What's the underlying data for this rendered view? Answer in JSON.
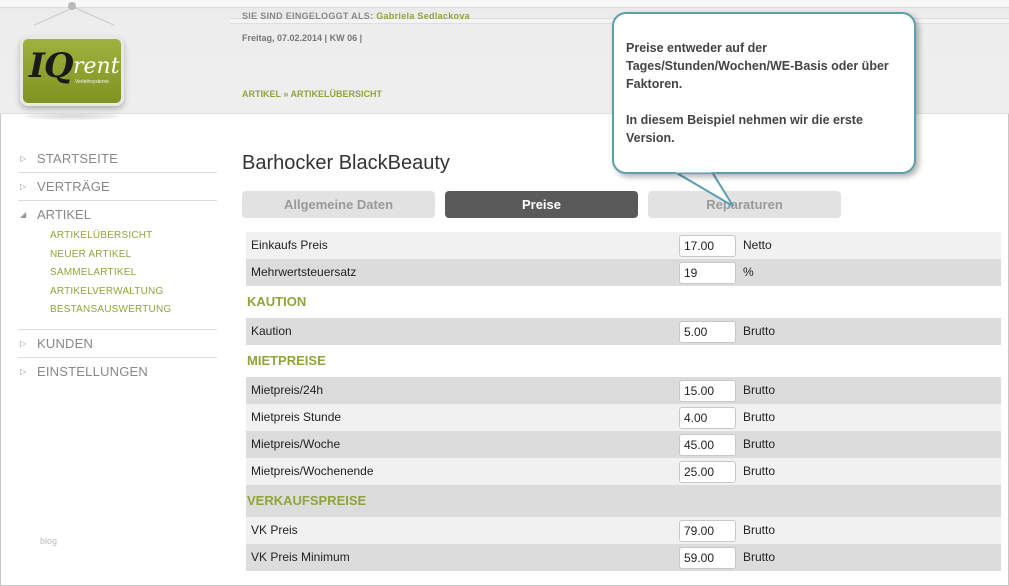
{
  "header": {
    "login_label": "SIE SIND EINGELOGGT ALS:",
    "login_user": "Gabriela Sedlackova",
    "date_line": "Freitag, 07.02.2014 | KW 06 |",
    "breadcrumb": "ARTIKEL » ARTIKELÜBERSICHT"
  },
  "logo": {
    "brand_iq": "IQ",
    "brand_rent": "rent",
    "tagline": "Verleihsysteme"
  },
  "nav": {
    "startseite": "STARTSEITE",
    "vertraege": "VERTRÄGE",
    "artikel": "ARTIKEL",
    "artikel_sub": [
      "ARTIKELÜBERSICHT",
      "NEUER ARTIKEL",
      "SAMMELARTIKEL",
      "ARTIKELVERWALTUNG",
      "BESTANSAUSWERTUNG"
    ],
    "kunden": "KUNDEN",
    "einstellungen": "EINSTELLUNGEN",
    "blog": "blog"
  },
  "page": {
    "title": "Barhocker BlackBeauty"
  },
  "tabs": {
    "allgemein": "Allgemeine Daten",
    "preise": "Preise",
    "reparaturen": "Reparaturen"
  },
  "rows": {
    "einkaufs": {
      "label": "Einkaufs Preis",
      "value": "17.00",
      "unit": "Netto"
    },
    "mwst": {
      "label": "Mehrwertsteuersatz",
      "value": "19",
      "unit": "%"
    },
    "kaution_section": "KAUTION",
    "kaution": {
      "label": "Kaution",
      "value": "5.00",
      "unit": "Brutto"
    },
    "miet_section": "MIETPREISE",
    "miet24": {
      "label": "Mietpreis/24h",
      "value": "15.00",
      "unit": "Brutto"
    },
    "mietstunde": {
      "label": "Mietpreis Stunde",
      "value": "4.00",
      "unit": "Brutto"
    },
    "mietwoche": {
      "label": "Mietpreis/Woche",
      "value": "45.00",
      "unit": "Brutto"
    },
    "mietwe": {
      "label": "Mietpreis/Wochenende",
      "value": "25.00",
      "unit": "Brutto"
    },
    "verkauf_section": "VERKAUFSPREISE",
    "vk": {
      "label": "VK Preis",
      "value": "79.00",
      "unit": "Brutto"
    },
    "vkmin": {
      "label": "VK Preis Minimum",
      "value": "59.00",
      "unit": "Brutto"
    }
  },
  "callout": {
    "line1": "Preise entweder auf der Tages/Stunden/Wochen/WE-Basis oder über Faktoren.",
    "line2": "In diesem Beispiel nehmen wir die erste Version."
  },
  "colors": {
    "accent": "#8fa53a",
    "callout_border": "#5b9fb0",
    "active_tab": "#5a5a5a"
  }
}
